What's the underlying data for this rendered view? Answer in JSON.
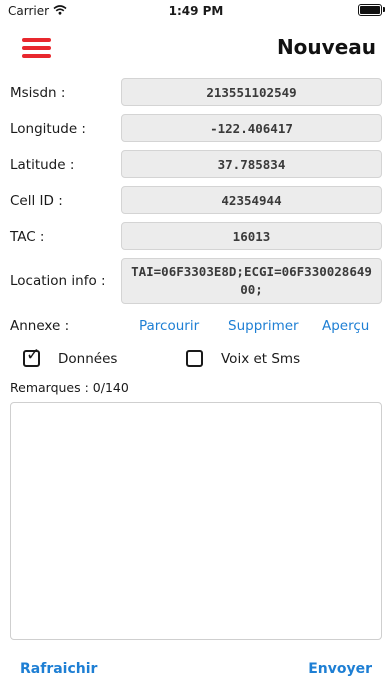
{
  "status_bar": {
    "carrier": "Carrier",
    "time": "1:49 PM"
  },
  "header": {
    "title": "Nouveau",
    "menu_icon": "hamburger-menu-icon",
    "accent_color": "#e8282e"
  },
  "fields": [
    {
      "label": "Msisdn :",
      "value": "213551102549"
    },
    {
      "label": "Longitude :",
      "value": "-122.406417"
    },
    {
      "label": "Latitude :",
      "value": "37.785834"
    },
    {
      "label": "Cell ID :",
      "value": "42354944"
    },
    {
      "label": "TAC :",
      "value": "16013"
    },
    {
      "label": "Location info :",
      "value": "TAI=06F3303E8D;ECGI=06F33002864900;"
    }
  ],
  "annexe": {
    "label": "Annexe :",
    "browse": "Parcourir",
    "delete": "Supprimer",
    "preview": "Aperçu",
    "link_color": "#1e7fd4"
  },
  "options": [
    {
      "label": "Données",
      "checked": true
    },
    {
      "label": "Voix et Sms",
      "checked": false
    }
  ],
  "remarks": {
    "label": "Remarques : 0/140",
    "value": ""
  },
  "footer": {
    "refresh": "Rafraichir",
    "send": "Envoyer"
  }
}
